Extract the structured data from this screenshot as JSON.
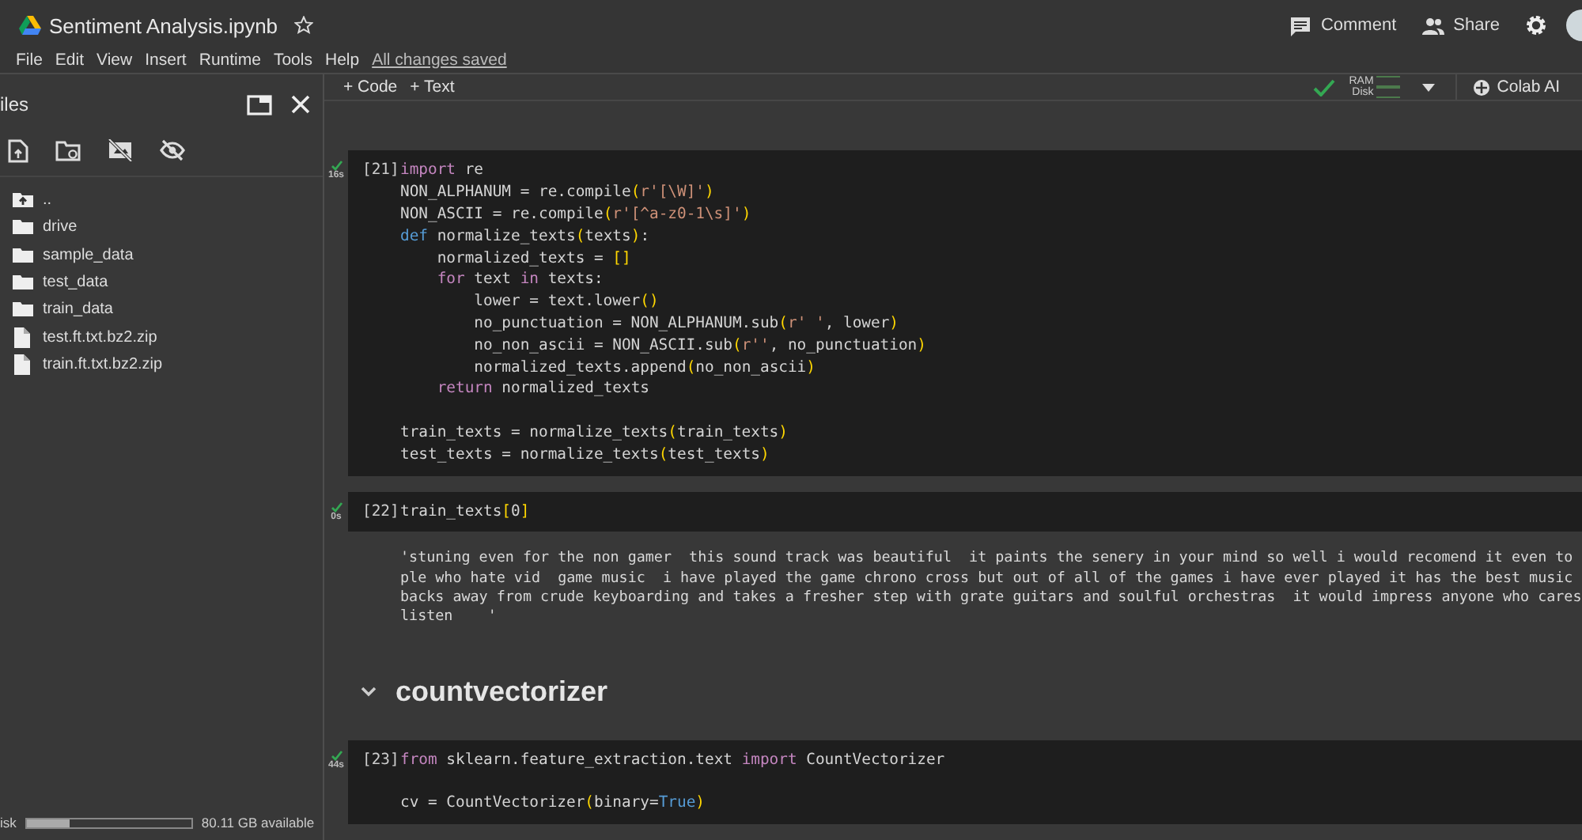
{
  "app": {
    "title": "Sentiment Analysis.ipynb",
    "starred": false,
    "menu": [
      "File",
      "Edit",
      "View",
      "Insert",
      "Runtime",
      "Tools",
      "Help"
    ],
    "save_status": "All changes saved",
    "actions": [
      {
        "label": "Comment",
        "kind": "comment"
      },
      {
        "label": "Share",
        "kind": "share"
      }
    ]
  },
  "toolbar": {
    "add_buttons": [
      "+ Code",
      "+ Text"
    ],
    "runtime": {
      "connected": true,
      "ram_label": "RAM",
      "disk_label": "Disk"
    },
    "ai_button": "Colab AI"
  },
  "sidebar": {
    "title": "iles",
    "items": [
      {
        "name": "..",
        "kind": "parent"
      },
      {
        "name": "drive",
        "kind": "folder"
      },
      {
        "name": "sample_data",
        "kind": "folder"
      },
      {
        "name": "test_data",
        "kind": "folder"
      },
      {
        "name": "train_data",
        "kind": "folder"
      },
      {
        "name": "test.ft.txt.bz2.zip",
        "kind": "file"
      },
      {
        "name": "train.ft.txt.bz2.zip",
        "kind": "file"
      }
    ],
    "disk": {
      "label": "isk",
      "level": 0.26,
      "available": "80.11 GB available"
    }
  },
  "cells": [
    {
      "kind": "code",
      "count": "[21]",
      "duration": "16s",
      "lines": [
        {
          "tokens": [
            {
              "text": "import",
              "kind": "kw"
            },
            {
              "text": " re",
              "kind": "p"
            }
          ]
        },
        {
          "tokens": [
            {
              "text": "NON_ALPHANUM = re.compile",
              "kind": "p"
            },
            {
              "text": "(",
              "kind": "br"
            },
            {
              "text": "r'[\\W]'",
              "kind": "str"
            },
            {
              "text": ")",
              "kind": "br"
            }
          ]
        },
        {
          "tokens": [
            {
              "text": "NON_ASCII = re.compile",
              "kind": "p"
            },
            {
              "text": "(",
              "kind": "br"
            },
            {
              "text": "r'[^a-z0-1\\s]'",
              "kind": "str"
            },
            {
              "text": ")",
              "kind": "br"
            }
          ]
        },
        {
          "tokens": [
            {
              "text": "def",
              "kind": "def"
            },
            {
              "text": " normalize_texts",
              "kind": "p"
            },
            {
              "text": "(",
              "kind": "br"
            },
            {
              "text": "texts",
              "kind": "p"
            },
            {
              "text": ")",
              "kind": "br"
            },
            {
              "text": ":",
              "kind": "p"
            }
          ]
        },
        {
          "tokens": [
            {
              "text": "    normalized_texts = ",
              "kind": "p"
            },
            {
              "text": "[]",
              "kind": "br"
            }
          ]
        },
        {
          "tokens": [
            {
              "text": "    for",
              "kind": "kw"
            },
            {
              "text": " text ",
              "kind": "p"
            },
            {
              "text": "in",
              "kind": "kw"
            },
            {
              "text": " texts:",
              "kind": "p"
            }
          ]
        },
        {
          "tokens": [
            {
              "text": "        lower = text.lower",
              "kind": "p"
            },
            {
              "text": "()",
              "kind": "br"
            }
          ]
        },
        {
          "tokens": [
            {
              "text": "        no_punctuation = NON_ALPHANUM.sub",
              "kind": "p"
            },
            {
              "text": "(",
              "kind": "br"
            },
            {
              "text": "r' '",
              "kind": "str"
            },
            {
              "text": ", lower",
              "kind": "p"
            },
            {
              "text": ")",
              "kind": "br"
            }
          ]
        },
        {
          "tokens": [
            {
              "text": "        no_non_ascii = NON_ASCII.sub",
              "kind": "p"
            },
            {
              "text": "(",
              "kind": "br"
            },
            {
              "text": "r''",
              "kind": "str"
            },
            {
              "text": ", no_punctuation",
              "kind": "p"
            },
            {
              "text": ")",
              "kind": "br"
            }
          ]
        },
        {
          "tokens": [
            {
              "text": "        normalized_texts.append",
              "kind": "p"
            },
            {
              "text": "(",
              "kind": "br"
            },
            {
              "text": "no_non_ascii",
              "kind": "p"
            },
            {
              "text": ")",
              "kind": "br"
            }
          ]
        },
        {
          "tokens": [
            {
              "text": "    return",
              "kind": "kw"
            },
            {
              "text": " normalized_texts",
              "kind": "p"
            }
          ]
        },
        {
          "tokens": [
            {
              "text": "train_texts = normalize_texts",
              "kind": "p"
            },
            {
              "text": "(",
              "kind": "br"
            },
            {
              "text": "train_texts",
              "kind": "p"
            },
            {
              "text": ")",
              "kind": "br"
            }
          ],
          "gap_before": true
        },
        {
          "tokens": [
            {
              "text": "test_texts = normalize_texts",
              "kind": "p"
            },
            {
              "text": "(",
              "kind": "br"
            },
            {
              "text": "test_texts",
              "kind": "p"
            },
            {
              "text": ")",
              "kind": "br"
            }
          ]
        }
      ]
    },
    {
      "kind": "code",
      "count": "[22]",
      "duration": "0s",
      "lines": [
        {
          "tokens": [
            {
              "text": "train_texts",
              "kind": "p"
            },
            {
              "text": "[",
              "kind": "br"
            },
            {
              "text": "0",
              "kind": "p"
            },
            {
              "text": "]",
              "kind": "br"
            }
          ]
        }
      ],
      "output": [
        "'stuning even for the non gamer  this sound track was beautiful  it paints the senery in your mind so well i would recomend it even to",
        "ple who hate vid  game music  i have played the game chrono cross but out of all of the games i have ever played it has the best music",
        "backs away from crude keyboarding and takes a fresher step with grate guitars and soulful orchestras  it would impress anyone who cares",
        "listen    '"
      ]
    },
    {
      "kind": "heading",
      "text": "countvectorizer",
      "expanded": true
    },
    {
      "kind": "code",
      "count": "[23]",
      "duration": "44s",
      "lines": [
        {
          "tokens": [
            {
              "text": "from",
              "kind": "kw"
            },
            {
              "text": " sklearn.feature_extraction.text ",
              "kind": "p"
            },
            {
              "text": "import",
              "kind": "kw"
            },
            {
              "text": " CountVectorizer",
              "kind": "p"
            }
          ]
        },
        {
          "tokens": [
            {
              "text": "cv = CountVectorizer",
              "kind": "p"
            },
            {
              "text": "(",
              "kind": "br"
            },
            {
              "text": "binary=",
              "kind": "p"
            },
            {
              "text": "True",
              "kind": "def"
            },
            {
              "text": ")",
              "kind": "br"
            }
          ],
          "gap_before": true
        }
      ]
    }
  ]
}
